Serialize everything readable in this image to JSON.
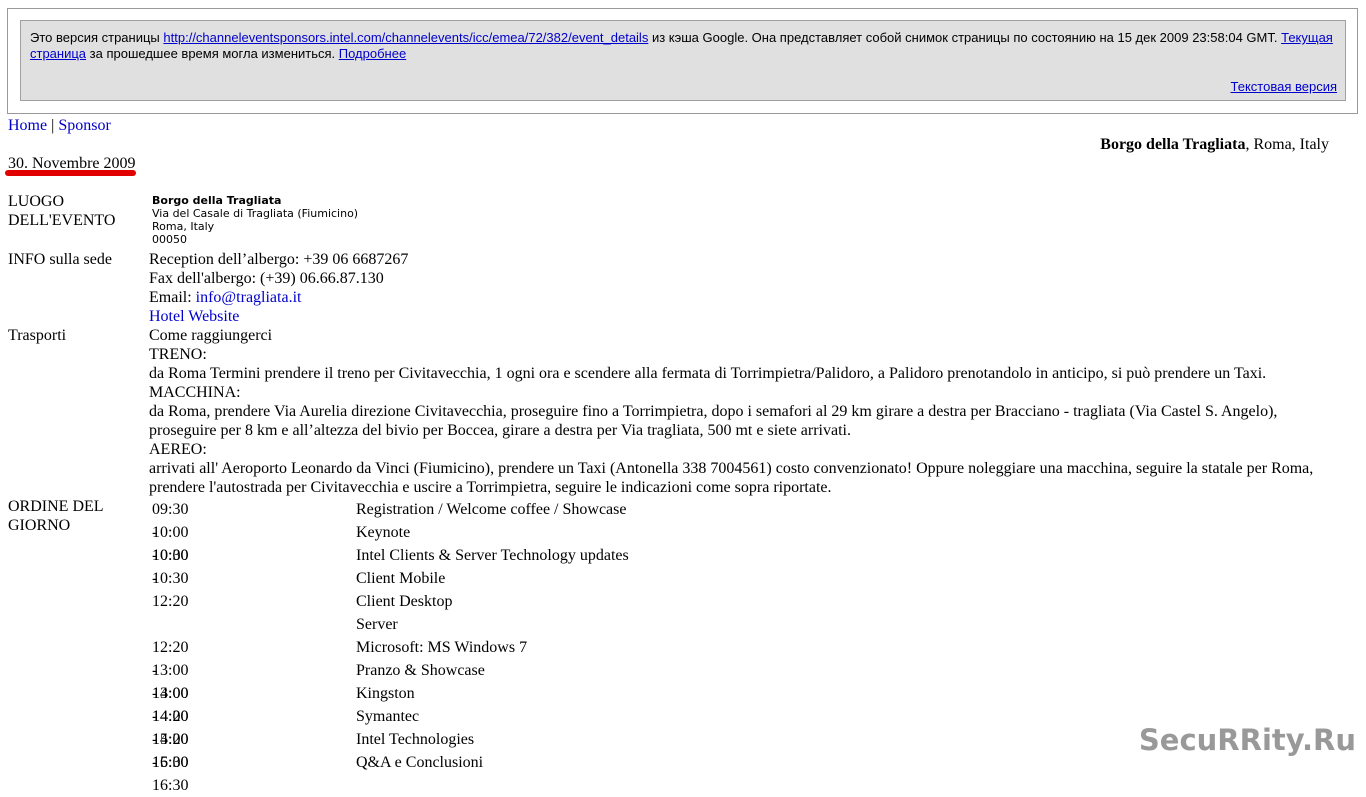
{
  "cache": {
    "prefix": "Это версия страницы",
    "url": "http://channeleventsponsors.intel.com/channelevents/icc/emea/72/382/event_details",
    "middle": "из кэша Google. Она представляет собой снимок страницы по состоянию на 15 дек 2009 23:58:04 GMT.",
    "current_link": "Текущая страница",
    "suffix": "за прошедшее время могла измениться.",
    "more_link": "Подробнее",
    "text_version_link": "Текстовая версия"
  },
  "nav": {
    "home": "Home",
    "separator": "|",
    "sponsor": "Sponsor"
  },
  "venue_header": {
    "name": "Borgo della Tragliata",
    "location": ", Roma, Italy"
  },
  "date": "30. Novembre 2009",
  "luogo": {
    "label_line1": "LUOGO",
    "label_line2": "DELL'EVENTO",
    "name": "Borgo della Tragliata",
    "street": "Via del Casale di Tragliata (Fiumicino)",
    "city": "Roma, Italy",
    "zip": "00050"
  },
  "info": {
    "label": "INFO sulla sede",
    "reception": "Reception dell’albergo: +39 06 6687267",
    "fax": "Fax dell'albergo: (+39) 06.66.87.130",
    "email_label": "Email:",
    "email": "info@tragliata.it",
    "website": "Hotel Website"
  },
  "trasporti": {
    "label": "Trasporti",
    "heading": "Come raggiungerci",
    "treno_label": "TRENO:",
    "treno_text": "da Roma Termini prendere il treno per Civitavecchia, 1 ogni ora e scendere alla fermata di Torrimpietra/Palidoro, a Palidoro prenotandolo in anticipo, si può prendere un Taxi.",
    "macchina_label": "MACCHINA:",
    "macchina_text": "da Roma, prendere Via Aurelia direzione Civitavecchia, proseguire fino a Torrimpietra, dopo i semafori al 29 km girare a destra per Bracciano - tragliata (Via Castel S. Angelo), proseguire per 8 km e all’altezza del bivio per Boccea, girare a destra per Via tragliata, 500 mt e siete arrivati.",
    "aereo_label": "AEREO:",
    "aereo_text": "arrivati all' Aeroporto Leonardo da Vinci (Fiumicino), prendere un Taxi (Antonella 338 7004561) costo convenzionato! Oppure noleggiare una macchina, seguire la statale per Roma, prendere l'autostrada per Civitavecchia e uscire a Torrimpietra, seguire le indicazioni come sopra riportate."
  },
  "ordine": {
    "label_line1": "ORDINE DEL",
    "label_line2": "GIORNO",
    "rows": [
      {
        "time": "09:30 - 10:00",
        "desc": "Registration / Welcome coffee / Showcase"
      },
      {
        "time": "10:00 - 10:30",
        "desc": "Keynote"
      },
      {
        "time": "10:30 - 12:20",
        "desc": "Intel Clients & Server Technology updates"
      },
      {
        "time": "",
        "desc": "Client Mobile"
      },
      {
        "time": "",
        "desc": "Client Desktop"
      },
      {
        "time": "",
        "desc": "Server"
      },
      {
        "time": "12:20 - 13:00",
        "desc": "Microsoft: MS Windows 7"
      },
      {
        "time": "13:00 - 14:00",
        "desc": "Pranzo & Showcase"
      },
      {
        "time": "14:00 - 14:20",
        "desc": "Kingston"
      },
      {
        "time": "14:20 - 15:00",
        "desc": "Symantec"
      },
      {
        "time": "15:00 - 16:30",
        "desc": "Intel Technologies"
      },
      {
        "time": "16:30",
        "desc": "Q&A e Conclusioni"
      }
    ]
  },
  "watermark": "SecuRRity.Ru"
}
